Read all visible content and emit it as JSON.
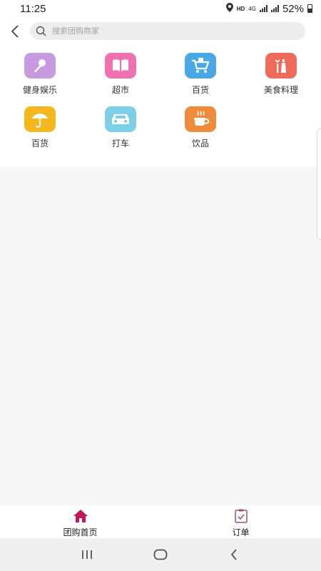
{
  "status_bar": {
    "time": "11:25",
    "hd": "HD",
    "network": "4G",
    "battery_percent": "52%"
  },
  "header": {
    "back_icon": "chevron-left-icon",
    "search_icon": "search-icon",
    "search_placeholder": "搜索团购商家"
  },
  "categories": [
    {
      "label": "健身娱乐",
      "icon": "microphone-icon",
      "color": "#c79ae0"
    },
    {
      "label": "超市",
      "icon": "book-icon",
      "color": "#f070b0"
    },
    {
      "label": "百货",
      "icon": "shopping-cart-icon",
      "color": "#4aa8e8"
    },
    {
      "label": "美食料理",
      "icon": "food-bottle-icon",
      "color": "#f06a5a"
    },
    {
      "label": "百货",
      "icon": "umbrella-icon",
      "color": "#f5b81c"
    },
    {
      "label": "打车",
      "icon": "car-icon",
      "color": "#7ccfe6"
    },
    {
      "label": "饮品",
      "icon": "coffee-cup-icon",
      "color": "#f08a3a"
    }
  ],
  "tab_bar": {
    "tabs": [
      {
        "label": "团购首页",
        "icon": "home-icon",
        "active": true
      },
      {
        "label": "订单",
        "icon": "clipboard-check-icon",
        "active": false
      }
    ],
    "active_color": "#c2185b"
  },
  "nav_bar": {
    "recents_icon": "recents-icon",
    "home_icon": "home-circle-icon",
    "back_icon": "back-chevron-icon"
  }
}
